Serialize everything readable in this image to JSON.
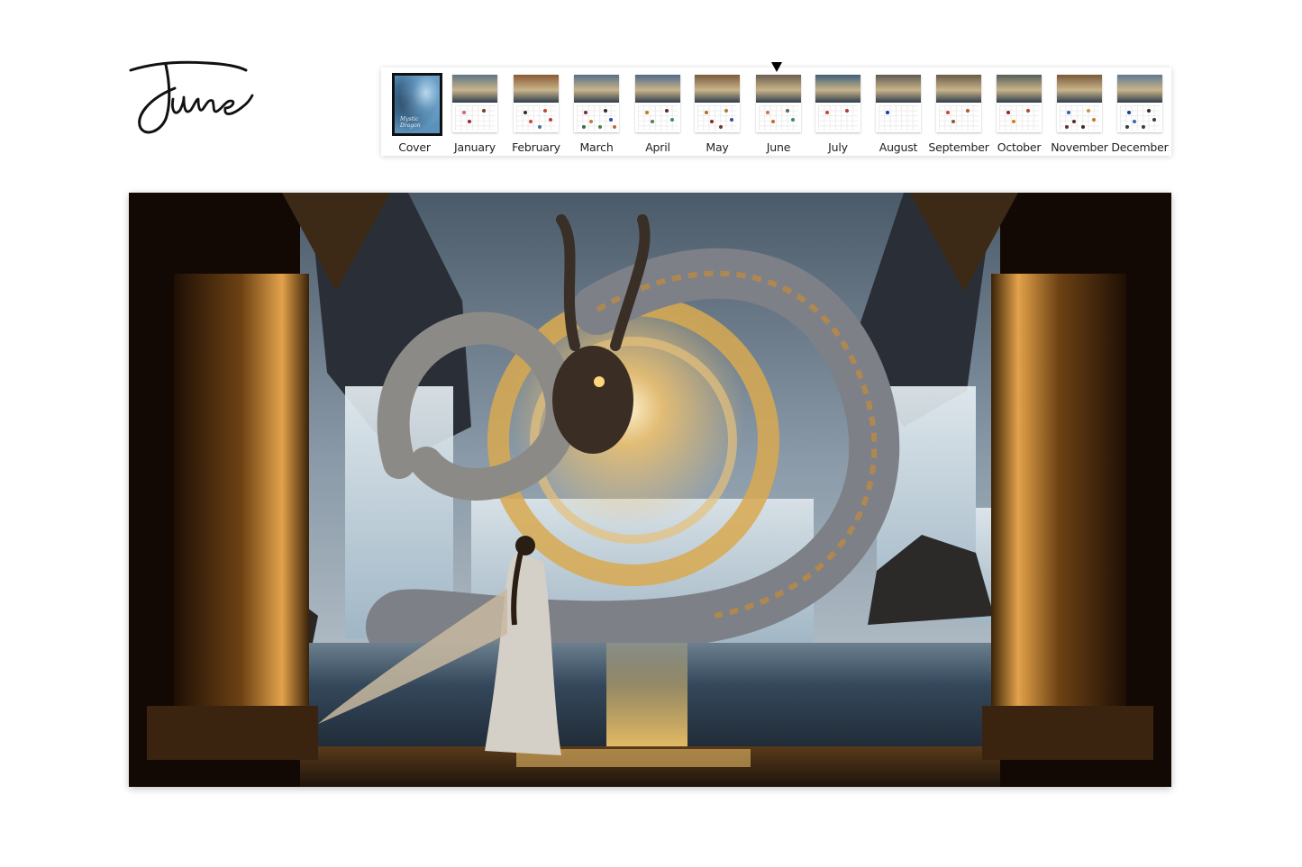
{
  "page": {
    "month_title": "June",
    "selected_month": "June"
  },
  "strip": {
    "items": [
      {
        "label": "Cover",
        "kind": "cover",
        "cover_text": "Mystic Dragon"
      },
      {
        "label": "January",
        "kind": "month",
        "dots": [
          "#c56a7a",
          "#7a3a2a",
          "#9a2a3a"
        ]
      },
      {
        "label": "February",
        "kind": "month",
        "dots": [
          "#3a2a1a",
          "#c04a2a",
          "#d04a3a",
          "#c03a3a",
          "#3a7a9a"
        ]
      },
      {
        "label": "March",
        "kind": "month",
        "dots": [
          "#7a2a3a",
          "#3a2a2a",
          "#c0803a",
          "#2a4aaa",
          "#3a8a3a",
          "#3a6a4a",
          "#c06a2a"
        ]
      },
      {
        "label": "April",
        "kind": "month",
        "dots": [
          "#c07a2a",
          "#5a2a2a",
          "#5a7a5a",
          "#3a8a6a"
        ]
      },
      {
        "label": "May",
        "kind": "month",
        "dots": [
          "#b0702a",
          "#b07a3a",
          "#8a2a3a",
          "#3a4aaa",
          "#6a3a2a"
        ]
      },
      {
        "label": "June",
        "kind": "month",
        "dots": [
          "#c07a5a",
          "#5a6a5a",
          "#c0702a",
          "#3a8a6a"
        ]
      },
      {
        "label": "July",
        "kind": "month",
        "dots": [
          "#c04a3a",
          "#b03a3a"
        ]
      },
      {
        "label": "August",
        "kind": "month",
        "dots": [
          "#1a3aaa"
        ]
      },
      {
        "label": "September",
        "kind": "month",
        "dots": [
          "#c04a3a",
          "#b05a2a",
          "#8a5a3a"
        ]
      },
      {
        "label": "October",
        "kind": "month",
        "dots": [
          "#8a2a2a",
          "#b04a2a",
          "#d0801a"
        ]
      },
      {
        "label": "November",
        "kind": "month",
        "dots": [
          "#3a5aaa",
          "#c09a3a",
          "#5a2a2a",
          "#c07a2a",
          "#3a2a2a",
          "#6a2a3a"
        ]
      },
      {
        "label": "December",
        "kind": "month",
        "dots": [
          "#2a3a8a",
          "#3a2a1a",
          "#3a6aaa",
          "#3a3a3a",
          "#3a3a3a",
          "#3a3a3a"
        ]
      }
    ]
  },
  "artwork": {
    "subject": "Golden dragon coiled around a glowing ornate ring before waterfalls, a woman in flowing robes watching from a temple terrace between bronze pillars",
    "palette": {
      "sky": "#5d7082",
      "sky_light": "#aab8c4",
      "cliff": "#2b3038",
      "water": "#33465a",
      "gold": "#e0a040",
      "gold_bright": "#ffd58a",
      "pillar": "#5a3410",
      "dragon": "#8a8f96",
      "robe": "#d8d4cc"
    }
  }
}
